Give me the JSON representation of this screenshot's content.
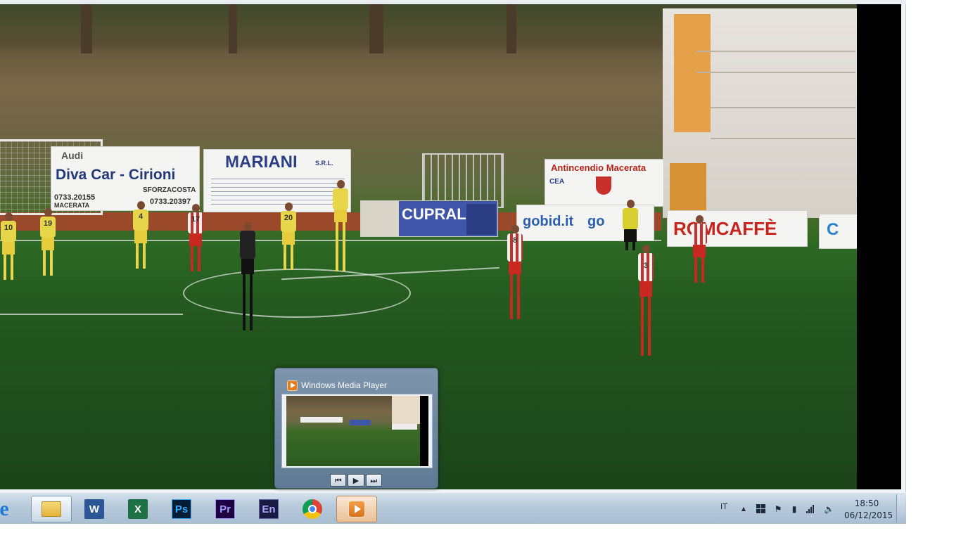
{
  "video": {
    "banners": {
      "audi": "Audi",
      "diva_car": "Diva Car - Cirioni",
      "diva_phone1": "0733.20155",
      "diva_phone2": "0733.20397",
      "diva_sub": "SFORZACOSTA",
      "diva_city": "MACERATA",
      "mariani": "MARIANI",
      "mariani_srl": "S.R.L.",
      "cupral": "CUPRAL",
      "antincendio": "Antincendio Macerata",
      "cea": "CEA",
      "gobid": "gobid.it",
      "gobid2": "go",
      "romcaffe": "ROMCAFFÈ",
      "partial": "C"
    },
    "players": {
      "yellow_numbers": [
        "10",
        "19",
        "4",
        "20"
      ],
      "red_numbers": [
        "17",
        "8",
        "3"
      ]
    }
  },
  "thumbnail": {
    "title": "Windows Media Player",
    "controls": {
      "prev": "⏮",
      "play": "▶",
      "next": "⏭"
    }
  },
  "taskbar": {
    "apps": [
      {
        "name": "internet-explorer",
        "label": "e"
      },
      {
        "name": "windows-explorer",
        "label": ""
      },
      {
        "name": "word",
        "label": "W"
      },
      {
        "name": "excel",
        "label": "X"
      },
      {
        "name": "photoshop",
        "label": "Ps"
      },
      {
        "name": "premiere",
        "label": "Pr"
      },
      {
        "name": "encore",
        "label": "En"
      },
      {
        "name": "chrome",
        "label": ""
      },
      {
        "name": "windows-media-player",
        "label": ""
      }
    ],
    "tray": {
      "language": "IT",
      "time": "18:50",
      "date": "06/12/2015"
    }
  },
  "colors": {
    "taskbar": "#b8cadb",
    "word": "#2b5797",
    "excel": "#1e7145",
    "photoshop": "#31a8ff",
    "premiere": "#9999ff",
    "encore": "#5e5ea8",
    "wmp": "#e07b20"
  }
}
